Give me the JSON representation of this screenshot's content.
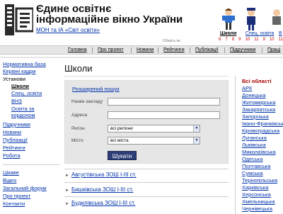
{
  "header": {
    "title_line1": "Єдине освітнє",
    "title_line2": "інформаційне вікно України",
    "subtitle": "МОН та ІА «Світ освіти»",
    "choose_hint": "Оберіть як:",
    "characters": [
      {
        "label": "Школи",
        "active": true
      },
      {
        "label": "Спец. освіта",
        "active": false
      },
      {
        "label": "В",
        "active": false
      }
    ],
    "grades": [
      "6",
      "7",
      "8",
      "9",
      "10",
      "11",
      "9",
      "10",
      "11"
    ]
  },
  "nav": {
    "items": [
      "Головна",
      "Про проект",
      "Новини",
      "Рейтинги",
      "Публікації",
      "Підручники",
      "Праці"
    ]
  },
  "sidebar": {
    "items": [
      {
        "label": "Нормативна база"
      },
      {
        "label": "Керівні кадри"
      },
      {
        "label": "Установи"
      },
      {
        "label": "Школи"
      },
      {
        "label": "Спец. освіта"
      },
      {
        "label": "ВНЗ"
      },
      {
        "label": "Освіта за"
      },
      {
        "label": "кордоном"
      },
      {
        "label": "Підручники"
      },
      {
        "label": "Новини"
      },
      {
        "label": "Публікації"
      },
      {
        "label": "Рейтинги"
      },
      {
        "label": "Робота"
      },
      {
        "label": "Цікаве"
      },
      {
        "label": "Відео"
      },
      {
        "label": "Загальний форум"
      },
      {
        "label": "Про проект"
      },
      {
        "label": "Контакти"
      }
    ]
  },
  "main": {
    "title": "Школи",
    "form": {
      "advanced": "Розширений пошук",
      "name_label": "Назва закладу",
      "address_label": "Адреса",
      "region_label": "Регіон",
      "region_value": "всі регіони",
      "city_label": "Місто",
      "city_value": "всі міста",
      "submit": "Шукати"
    },
    "results": [
      "Августівська ЗОШ І-ІІІ ст.",
      "Бишківська ЗОШ І-ІІІ ст.",
      "Будилівська ЗОШ І-ІІІ ст."
    ]
  },
  "regions": {
    "all": "Всі області",
    "items": [
      "АРК",
      "Донецька",
      "Житомирська",
      "Закарпатська",
      "Запорізька",
      "Івано-Франківська",
      "Кіровоградська",
      "Луганська",
      "Львівська",
      "Миколаївська",
      "Одеська",
      "Полтавська",
      "Сумська",
      "Тернопільська",
      "Харківська",
      "Херсонська",
      "Хмельницька",
      "Чернівецька"
    ]
  },
  "colors": {
    "link": "#0033aa",
    "button": "#2e3e78",
    "region_active": "#aa0000"
  }
}
